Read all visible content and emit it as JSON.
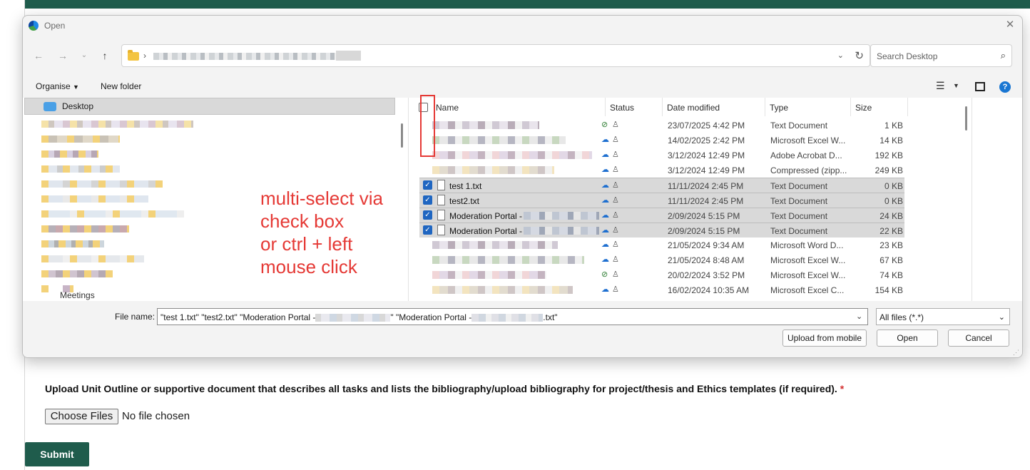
{
  "dialog": {
    "title": "Open",
    "search_placeholder": "Search Desktop",
    "toolbar": {
      "organise": "Organise",
      "new_folder": "New folder"
    },
    "nav": {
      "desktop": "Desktop",
      "meetings": "Meetings"
    },
    "columns": {
      "name": "Name",
      "status": "Status",
      "date": "Date modified",
      "type": "Type",
      "size": "Size"
    },
    "rows": [
      {
        "name": "",
        "status": "synced",
        "date": "23/07/2025 4:42 PM",
        "type": "Text Document",
        "size": "1 KB",
        "selected": false
      },
      {
        "name": "",
        "status": "cloud",
        "date": "14/02/2025 2:42 PM",
        "type": "Microsoft Excel W...",
        "size": "14 KB",
        "selected": false
      },
      {
        "name": "",
        "status": "cloud",
        "date": "3/12/2024 12:49 PM",
        "type": "Adobe Acrobat D...",
        "size": "192 KB",
        "selected": false
      },
      {
        "name": "",
        "status": "cloud",
        "date": "3/12/2024 12:49 PM",
        "type": "Compressed (zipp...",
        "size": "249 KB",
        "selected": false
      },
      {
        "name": "test 1.txt",
        "status": "cloud",
        "date": "11/11/2024 2:45 PM",
        "type": "Text Document",
        "size": "0 KB",
        "selected": true
      },
      {
        "name": "test2.txt",
        "status": "cloud",
        "date": "11/11/2024 2:45 PM",
        "type": "Text Document",
        "size": "0 KB",
        "selected": true
      },
      {
        "name": "Moderation Portal -",
        "status": "cloud",
        "date": "2/09/2024 5:15 PM",
        "type": "Text Document",
        "size": "24 KB",
        "selected": true
      },
      {
        "name": "Moderation Portal -",
        "status": "cloud",
        "date": "2/09/2024 5:15 PM",
        "type": "Text Document",
        "size": "22 KB",
        "selected": true
      },
      {
        "name": "",
        "status": "cloud",
        "date": "21/05/2024 9:34 AM",
        "type": "Microsoft Word D...",
        "size": "23 KB",
        "selected": false
      },
      {
        "name": "",
        "status": "cloud",
        "date": "21/05/2024 8:48 AM",
        "type": "Microsoft Excel W...",
        "size": "67 KB",
        "selected": false
      },
      {
        "name": "",
        "status": "synced",
        "date": "20/02/2024 3:52 PM",
        "type": "Microsoft Excel W...",
        "size": "74 KB",
        "selected": false
      },
      {
        "name": "",
        "status": "cloud",
        "date": "16/02/2024 10:35 AM",
        "type": "Microsoft Excel C...",
        "size": "154 KB",
        "selected": false
      }
    ],
    "annotation": "multi-select via\ncheck box\nor ctrl + left\nmouse click",
    "file_name_label": "File name:",
    "file_name_part1": "\"test 1.txt\" \"test2.txt\" \"Moderation Portal -",
    "file_name_part2": "\" \"Moderation Portal -",
    "file_name_part3": ".txt\"",
    "filter": "All files (*.*)",
    "upload_mobile": "Upload from mobile",
    "open": "Open",
    "cancel": "Cancel"
  },
  "page": {
    "upload_label": "Upload Unit Outline or supportive document that describes all tasks and lists the bibliography/upload bibliography for project/thesis and Ethics templates (if required).",
    "required_mark": "*",
    "choose_files": "Choose Files",
    "no_file": "No file chosen",
    "submit": "Submit"
  },
  "colors": {
    "accent": "#1f5c4c",
    "checkbox": "#1f66c1",
    "annotation": "#e53935"
  }
}
